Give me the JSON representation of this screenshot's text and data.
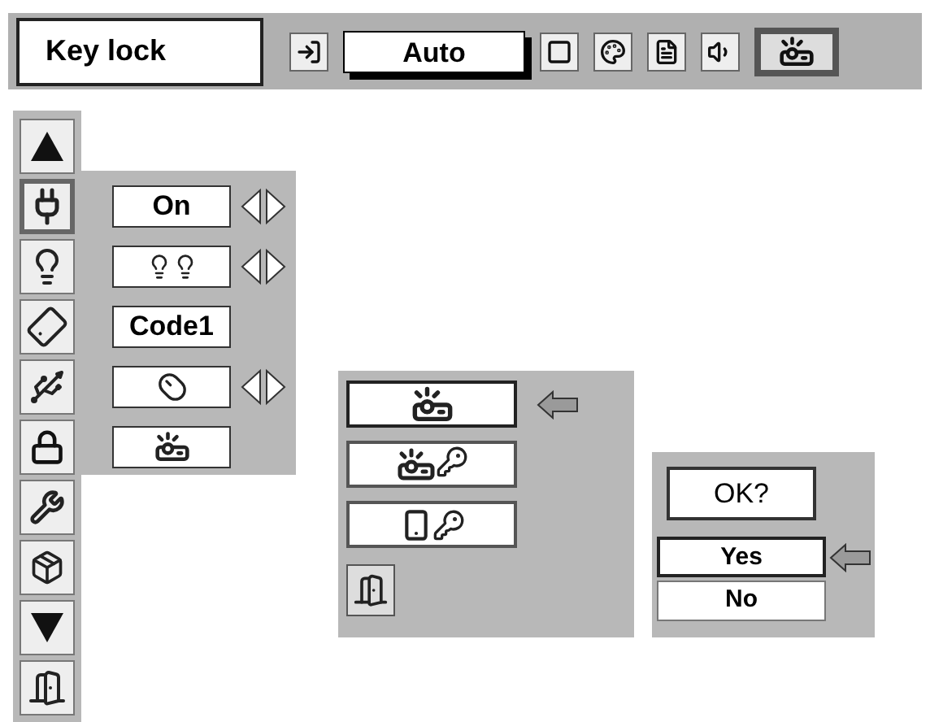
{
  "header": {
    "title": "Key lock"
  },
  "toolbar": [
    {
      "kind": "icon",
      "selected": false
    },
    {
      "kind": "text",
      "label": "Auto",
      "selected": false
    },
    {
      "kind": "icon",
      "selected": false
    },
    {
      "kind": "icon",
      "selected": false
    },
    {
      "kind": "icon",
      "selected": false
    },
    {
      "kind": "icon",
      "selected": false
    },
    {
      "kind": "icon",
      "selected": true
    }
  ],
  "side_menu": [
    {
      "selected": false
    },
    {
      "selected": true
    },
    {
      "selected": false
    },
    {
      "selected": false
    },
    {
      "selected": false
    },
    {
      "selected": false
    },
    {
      "selected": false
    },
    {
      "selected": false
    },
    {
      "selected": false
    },
    {
      "selected": false
    }
  ],
  "settings": [
    {
      "value": "On",
      "adjustable": true
    },
    {
      "adjustable": true
    },
    {
      "value": "Code1",
      "adjustable": false
    },
    {
      "adjustable": true
    },
    {
      "adjustable": false
    }
  ],
  "key_lock_options": [
    {
      "selected": true
    },
    {
      "selected": false
    },
    {
      "selected": false
    }
  ],
  "confirm": {
    "title": "OK?",
    "options": [
      {
        "label": "Yes",
        "selected": true
      },
      {
        "label": "No",
        "selected": false
      }
    ]
  }
}
